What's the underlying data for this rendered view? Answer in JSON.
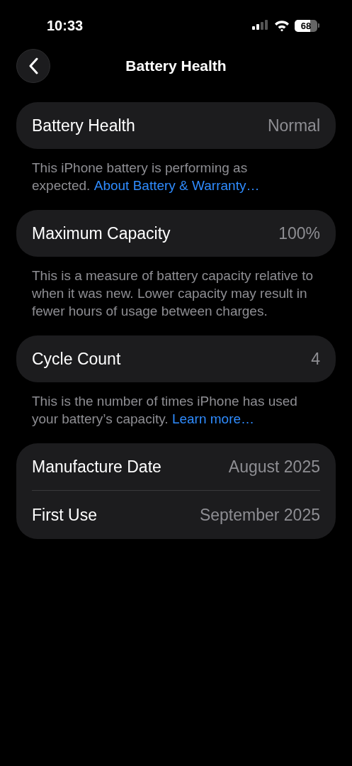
{
  "status_bar": {
    "time": "10:33",
    "battery": "68"
  },
  "nav": {
    "title": "Battery Health"
  },
  "groups": [
    {
      "rows": [
        {
          "label": "Battery Health",
          "value": "Normal"
        }
      ],
      "footer": {
        "text": "This iPhone battery is performing as expected.",
        "link": "About Battery & Warranty…"
      }
    },
    {
      "rows": [
        {
          "label": "Maximum Capacity",
          "value": "100%"
        }
      ],
      "footer": {
        "text": "This is a measure of battery capacity relative to when it was new. Lower capacity may result in fewer hours of usage between charges."
      }
    },
    {
      "rows": [
        {
          "label": "Cycle Count",
          "value": "4"
        }
      ],
      "footer": {
        "text": "This is the number of times iPhone has used your battery’s capacity.",
        "link": "Learn more…"
      }
    },
    {
      "rows": [
        {
          "label": "Manufacture Date",
          "value": "August 2025"
        },
        {
          "label": "First Use",
          "value": "September 2025"
        }
      ]
    }
  ]
}
